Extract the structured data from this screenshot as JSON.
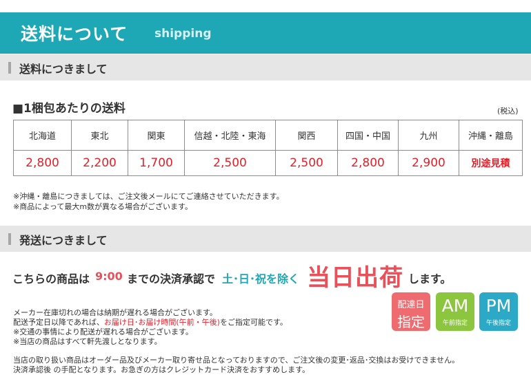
{
  "header": {
    "title": "送料について",
    "subtitle": "shipping"
  },
  "section1": {
    "heading": "送料につきまして"
  },
  "rates": {
    "title": "■1梱包あたりの送料",
    "tax_note": "(税込)",
    "regions": [
      "北海道",
      "東北",
      "関東",
      "信越・北陸・東海",
      "関西",
      "四国・中国",
      "九州",
      "沖縄・離島"
    ],
    "prices": [
      "2,800",
      "2,200",
      "1,700",
      "2,500",
      "2,500",
      "2,800",
      "2,900",
      "別途見積"
    ]
  },
  "rate_notes": [
    "※沖縄・離島につきましては、ご注文後メールにてご連絡させていただきます。",
    "※商品によって最大m数が異なる場合がございます。"
  ],
  "section2": {
    "heading": "発送につきまして"
  },
  "shipping": {
    "lead": "こちらの商品は",
    "time": "9:00",
    "mid": "までの決済承認で",
    "holidays": "土･日･祝を除く",
    "same_day": "当日出荷",
    "end": "します。"
  },
  "info": {
    "line1": "メーカー在庫切れの場合は納期が遅れる場合がございます。",
    "line2_a": "配送予定日以降であれば、",
    "line2_b": "お届け日･お届け時間(午前・午後)",
    "line2_c": "をご指定可能です。",
    "line3": "※交通の事情により配送が遅れる場合がございます。",
    "line4": "※当店の商品はすべて軒先渡しとなります。",
    "line5": "当店の取り扱い商品はオーダー品及びメーカー取り寄せ品となっておりますので、ご注文後の変更･返品･交換はお受けできません。",
    "line6": "決済承認後 の手配となります。お急ぎの方はクレジットカード決済をおすすめします。"
  },
  "badges": {
    "delivery_line1": "配達日",
    "delivery_line2": "指定",
    "am_big": "AM",
    "am_small": "午前指定",
    "pm_big": "PM",
    "pm_small": "午後指定"
  },
  "colors": {
    "teal": "#1ea8b6",
    "red": "#e61e28",
    "pink": "#ee6b6f",
    "green": "#8cc63f",
    "blue": "#2ba9c6"
  }
}
